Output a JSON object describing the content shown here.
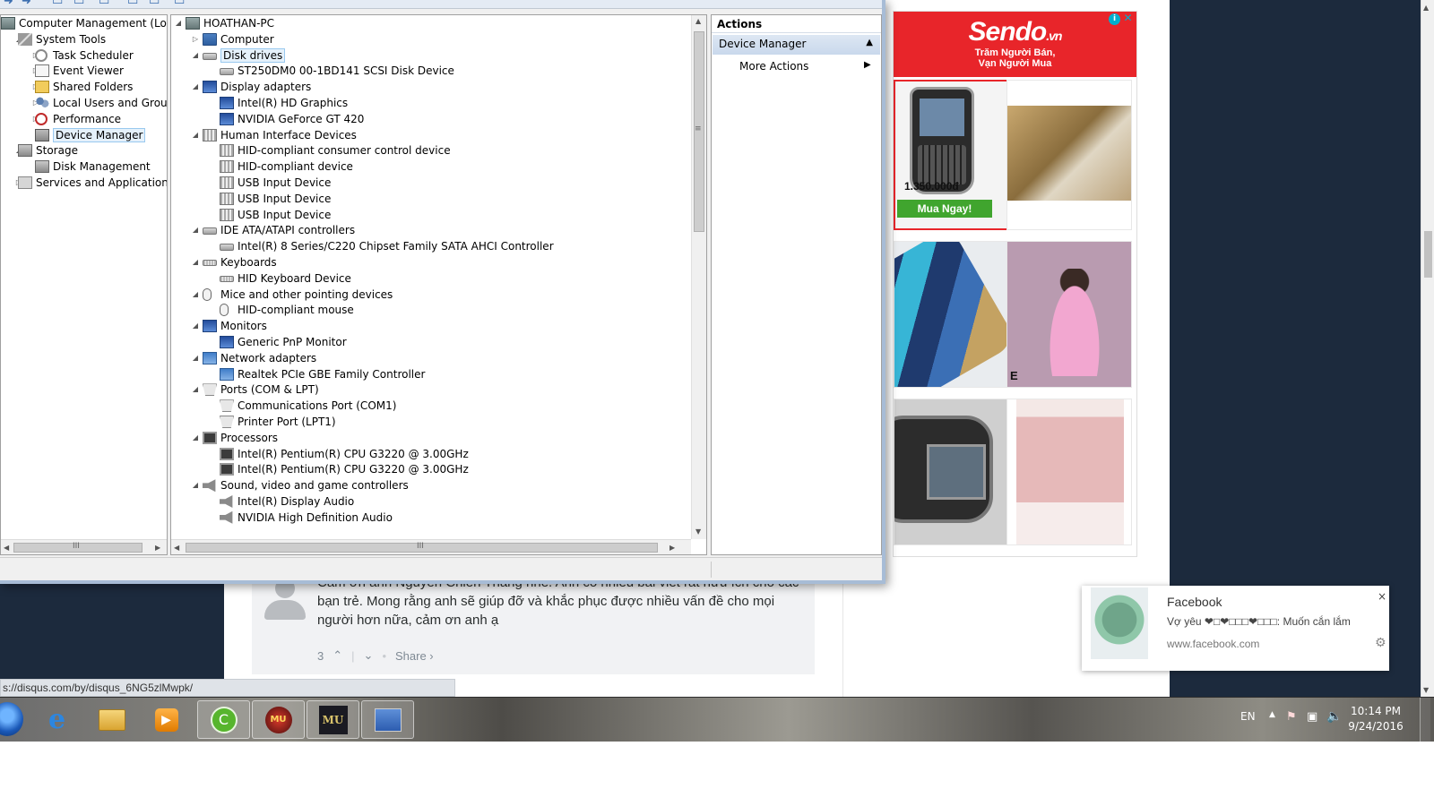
{
  "browser": {
    "status_url": "s://disqus.com/by/disqus_6NG5zlMwpk/",
    "comment": {
      "text": "Cảm ơn anh Nguyễn Chiến Thắng nhé. Anh có nhiều bài viết rất hữu ích cho các bạn trẻ. Mong rằng anh sẽ giúp đỡ và khắc phục được nhiều vấn đề cho mọi người hơn nữa, cảm ơn anh ạ",
      "votes": "3",
      "share": "Share ›"
    },
    "ad": {
      "brand": "Sendo",
      "brand_suffix": ".vn",
      "tagline1": "Trăm Người Bán,",
      "tagline2": "Vạn Người Mua",
      "info": "i",
      "close": "✕",
      "price": "1.350.000đ",
      "buy": "Mua Ngay!",
      "tile4_caption": "E"
    },
    "notification": {
      "title": "Facebook",
      "body": "Vợ yêu ❤□❤□□□❤□□□: Muốn cắn lắm",
      "url": "www.facebook.com",
      "close": "×",
      "settings": "⚙"
    }
  },
  "mmc": {
    "tree": [
      {
        "label": "Computer Management (Local",
        "icon": "computer-management-icon",
        "indent": 0,
        "arrow": ""
      },
      {
        "label": "System Tools",
        "icon": "system-tools-icon",
        "indent": 1,
        "arrow": "◢"
      },
      {
        "label": "Task Scheduler",
        "icon": "task-scheduler-icon",
        "indent": 2,
        "arrow": "▷"
      },
      {
        "label": "Event Viewer",
        "icon": "event-viewer-icon",
        "indent": 2,
        "arrow": "▷"
      },
      {
        "label": "Shared Folders",
        "icon": "shared-folders-icon",
        "indent": 2,
        "arrow": "▷"
      },
      {
        "label": "Local Users and Groups",
        "icon": "local-users-icon",
        "indent": 2,
        "arrow": "▷"
      },
      {
        "label": "Performance",
        "icon": "performance-icon",
        "indent": 2,
        "arrow": "▷"
      },
      {
        "label": "Device Manager",
        "icon": "device-manager-icon",
        "indent": 2,
        "arrow": "",
        "selected": true
      },
      {
        "label": "Storage",
        "icon": "storage-icon",
        "indent": 1,
        "arrow": "◢"
      },
      {
        "label": "Disk Management",
        "icon": "disk-management-icon",
        "indent": 2,
        "arrow": ""
      },
      {
        "label": "Services and Applications",
        "icon": "services-icon",
        "indent": 1,
        "arrow": "▷"
      }
    ],
    "devices": [
      {
        "label": "HOATHAN-PC",
        "icon": "pc-icon",
        "level": 0,
        "arrow": "◢"
      },
      {
        "label": "Computer",
        "icon": "computer-icon",
        "level": 1,
        "arrow": "▷"
      },
      {
        "label": "Disk drives",
        "icon": "disk-drive-icon",
        "level": 1,
        "arrow": "◢",
        "selected": true
      },
      {
        "label": "ST250DM0 00-1BD141 SCSI Disk Device",
        "icon": "disk-drive-icon",
        "level": 2,
        "arrow": ""
      },
      {
        "label": "Display adapters",
        "icon": "display-adapter-icon",
        "level": 1,
        "arrow": "◢"
      },
      {
        "label": "Intel(R) HD Graphics",
        "icon": "display-adapter-icon",
        "level": 2,
        "arrow": ""
      },
      {
        "label": "NVIDIA GeForce GT 420",
        "icon": "display-adapter-icon",
        "level": 2,
        "arrow": ""
      },
      {
        "label": "Human Interface Devices",
        "icon": "hid-icon",
        "level": 1,
        "arrow": "◢"
      },
      {
        "label": "HID-compliant consumer control device",
        "icon": "hid-icon",
        "level": 2,
        "arrow": ""
      },
      {
        "label": "HID-compliant device",
        "icon": "hid-icon",
        "level": 2,
        "arrow": ""
      },
      {
        "label": "USB Input Device",
        "icon": "hid-icon",
        "level": 2,
        "arrow": ""
      },
      {
        "label": "USB Input Device",
        "icon": "hid-icon",
        "level": 2,
        "arrow": ""
      },
      {
        "label": "USB Input Device",
        "icon": "hid-icon",
        "level": 2,
        "arrow": ""
      },
      {
        "label": "IDE ATA/ATAPI controllers",
        "icon": "ide-controller-icon",
        "level": 1,
        "arrow": "◢"
      },
      {
        "label": "Intel(R) 8 Series/C220 Chipset Family SATA AHCI Controller",
        "icon": "ide-controller-icon",
        "level": 2,
        "arrow": ""
      },
      {
        "label": "Keyboards",
        "icon": "keyboard-icon",
        "level": 1,
        "arrow": "◢"
      },
      {
        "label": "HID Keyboard Device",
        "icon": "keyboard-icon",
        "level": 2,
        "arrow": ""
      },
      {
        "label": "Mice and other pointing devices",
        "icon": "mouse-icon",
        "level": 1,
        "arrow": "◢"
      },
      {
        "label": "HID-compliant mouse",
        "icon": "mouse-icon",
        "level": 2,
        "arrow": ""
      },
      {
        "label": "Monitors",
        "icon": "monitor-icon",
        "level": 1,
        "arrow": "◢"
      },
      {
        "label": "Generic PnP Monitor",
        "icon": "monitor-icon",
        "level": 2,
        "arrow": ""
      },
      {
        "label": "Network adapters",
        "icon": "network-adapter-icon",
        "level": 1,
        "arrow": "◢"
      },
      {
        "label": "Realtek PCIe GBE Family Controller",
        "icon": "network-adapter-icon",
        "level": 2,
        "arrow": ""
      },
      {
        "label": "Ports (COM & LPT)",
        "icon": "port-icon",
        "level": 1,
        "arrow": "◢"
      },
      {
        "label": "Communications Port (COM1)",
        "icon": "port-icon",
        "level": 2,
        "arrow": ""
      },
      {
        "label": "Printer Port (LPT1)",
        "icon": "port-icon",
        "level": 2,
        "arrow": ""
      },
      {
        "label": "Processors",
        "icon": "processor-icon",
        "level": 1,
        "arrow": "◢"
      },
      {
        "label": "Intel(R) Pentium(R) CPU G3220 @ 3.00GHz",
        "icon": "processor-icon",
        "level": 2,
        "arrow": ""
      },
      {
        "label": "Intel(R) Pentium(R) CPU G3220 @ 3.00GHz",
        "icon": "processor-icon",
        "level": 2,
        "arrow": ""
      },
      {
        "label": "Sound, video and game controllers",
        "icon": "sound-icon",
        "level": 1,
        "arrow": "◢"
      },
      {
        "label": "Intel(R) Display Audio",
        "icon": "sound-icon",
        "level": 2,
        "arrow": ""
      },
      {
        "label": "NVIDIA High Definition Audio",
        "icon": "sound-icon",
        "level": 2,
        "arrow": ""
      }
    ],
    "actions": {
      "header": "Actions",
      "section": "Device Manager",
      "item": "More Actions"
    },
    "scroll_grip": "III"
  },
  "taskbar": {
    "apps": [
      {
        "name": "internet-explorer-icon",
        "glyph": "e"
      },
      {
        "name": "file-explorer-icon",
        "glyph": ""
      },
      {
        "name": "media-player-icon",
        "glyph": "▶"
      },
      {
        "name": "coc-coc-browser-icon",
        "glyph": "C"
      },
      {
        "name": "game-icon",
        "glyph": "MU"
      },
      {
        "name": "mu-online-icon",
        "glyph": "MU"
      },
      {
        "name": "computer-management-icon",
        "glyph": ""
      }
    ],
    "tray": {
      "language": "EN",
      "time": "10:14 PM",
      "date": "9/24/2016"
    }
  }
}
